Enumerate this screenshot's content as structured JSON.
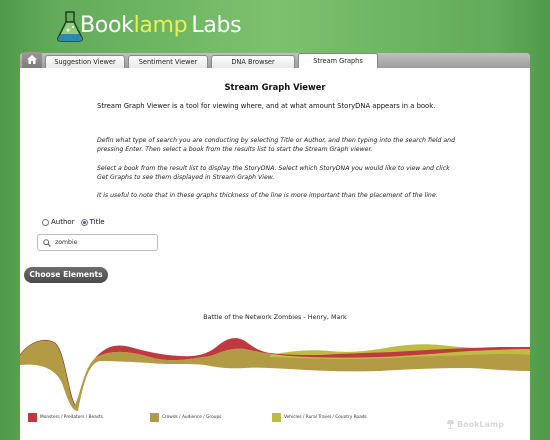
{
  "brand": {
    "part1": "Book",
    "part2": "lamp",
    "part3": "Labs"
  },
  "tabs": [
    {
      "label": "Suggestion Viewer"
    },
    {
      "label": "Sentiment Viewer"
    },
    {
      "label": "DNA Browser"
    },
    {
      "label": "Stream Graphs"
    }
  ],
  "active_tab": "Stream Graphs",
  "page": {
    "title": "Stream Graph Viewer",
    "intro": "Stream Graph Viewer is a tool for viewing where, and at what amount StoryDNA appears in a book.",
    "instructions": [
      "Defin what type of search you are conducting by selecting Title or Author, and then typing into the search field and pressing Enter. Then select a book from the results list to start the Stream Graph viewer.",
      "Select a book from the result list to display the StoryDNA. Select which StoryDNA you would like to view and click Get Graphs to see them displayed in Stream Graph View.",
      "It is useful to note that in these graphs thickness of the line is more important than the placement of the line."
    ]
  },
  "search": {
    "options": [
      {
        "label": "Author",
        "checked": false
      },
      {
        "label": "Title",
        "checked": true
      }
    ],
    "value": "zombie"
  },
  "choose_button": "Choose Elements",
  "chart_data": {
    "type": "area",
    "title": "Battle of the Network Zombies - Henry, Mark",
    "series": [
      {
        "name": "Monsters / Predators / Beasts",
        "color": "#c0393f"
      },
      {
        "name": "Crowds / Audience / Groups",
        "color": "#b39a45"
      },
      {
        "name": "Vehicles / Rural Travel / Country Roads",
        "color": "#bfbc44"
      }
    ]
  },
  "watermark": "BookLamp"
}
